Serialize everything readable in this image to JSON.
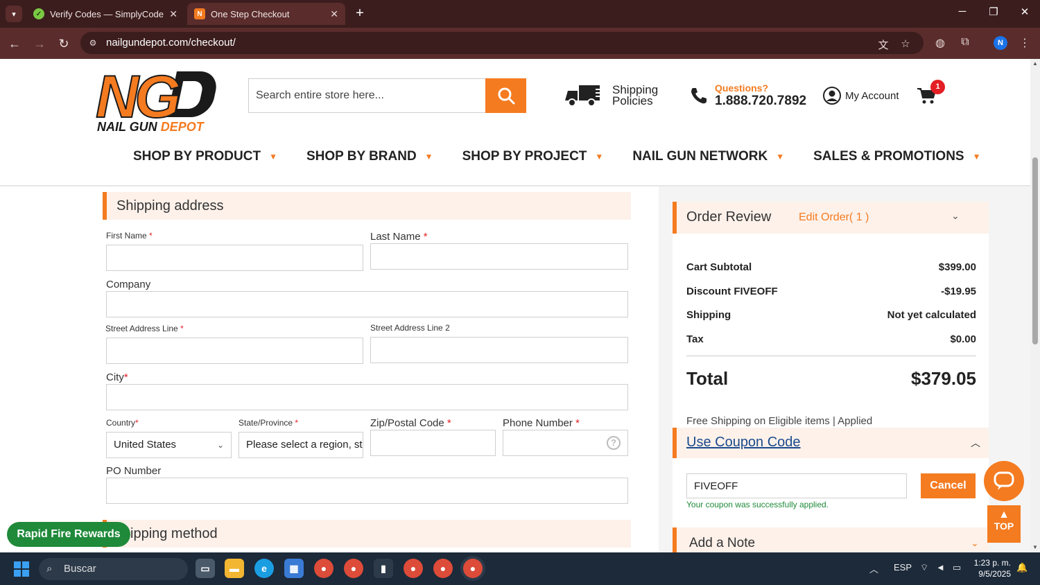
{
  "browser": {
    "tabs": [
      {
        "title": "Verify Codes — SimplyCodes",
        "active": false
      },
      {
        "title": "One Step Checkout",
        "active": true
      }
    ],
    "url": "nailgundepot.com/checkout/",
    "profile_initial": "N"
  },
  "header": {
    "logo_text_ng": "NG",
    "logo_brand": "NAIL GUN",
    "logo_brand_accent": "DEPOT",
    "search_placeholder": "Search entire store here...",
    "shipping_policies": "Shipping Policies",
    "questions_label": "Questions?",
    "phone": "1.888.720.7892",
    "my_account": "My Account",
    "cart_count": "1"
  },
  "nav": {
    "items": [
      "SHOP BY PRODUCT",
      "SHOP BY BRAND",
      "SHOP BY PROJECT",
      "NAIL GUN NETWORK",
      "SALES & PROMOTIONS"
    ]
  },
  "shipping_address": {
    "title": "Shipping address",
    "first_name": "First Name",
    "last_name": "Last Name",
    "company": "Company",
    "street1": "Street Address Line",
    "street2": "Street Address Line 2",
    "city": "City",
    "country": "Country",
    "country_value": "United States",
    "state": "State/Province",
    "state_value": "Please select a region, sta",
    "zip": "Zip/Postal Code",
    "phone": "Phone Number",
    "po": "PO Number",
    "required_mark": "*"
  },
  "shipping_method": {
    "title": "ipping method"
  },
  "rapid_fire": "Rapid Fire Rewards",
  "order_review": {
    "title": "Order Review",
    "edit": "Edit Order( 1 )",
    "rows": [
      {
        "label": "Cart Subtotal",
        "value": "$399.00"
      },
      {
        "label": "Discount FIVEOFF",
        "value": "-$19.95"
      },
      {
        "label": "Shipping",
        "value": "Not yet calculated"
      },
      {
        "label": "Tax",
        "value": "$0.00"
      }
    ],
    "total_label": "Total",
    "total_value": "$379.05",
    "free_shipping": "Free Shipping on Eligible items | Applied"
  },
  "coupon": {
    "title": "Use Coupon Code",
    "value": "FIVEOFF",
    "cancel": "Cancel",
    "message": "Your coupon was successfully applied."
  },
  "note": {
    "title": "Add a Note"
  },
  "top_button": "TOP",
  "taskbar": {
    "search": "Buscar",
    "lang": "ESP",
    "time": "1:23 p. m.",
    "date": "9/5/2025"
  },
  "colors": {
    "accent": "#f47b20",
    "success": "#1f8a3a",
    "chrome": "#5a2c2c"
  }
}
